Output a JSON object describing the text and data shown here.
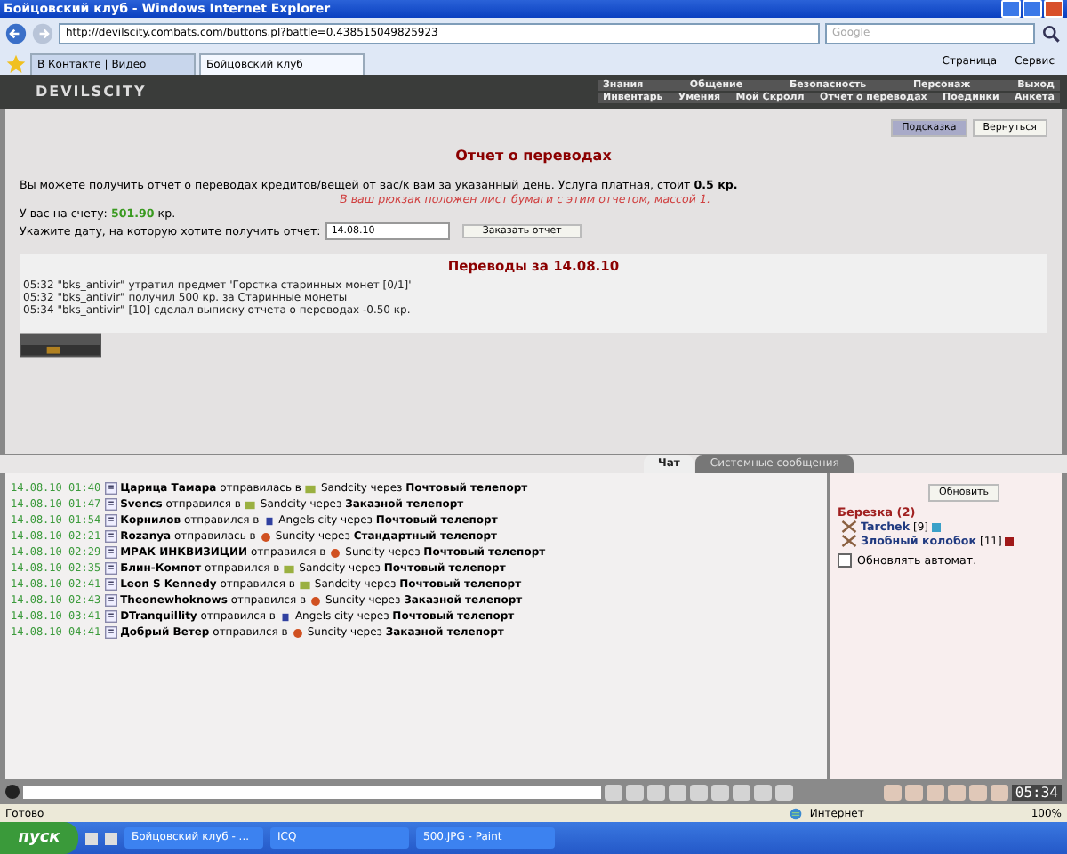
{
  "window": {
    "title": "Бойцовский клуб - Windows Internet Explorer"
  },
  "address": "http://devilscity.combats.com/buttons.pl?battle=0.438515049825923",
  "search": {
    "placeholder": "Google"
  },
  "tabs": [
    {
      "label": "В Контакте | Видео",
      "selected": false
    },
    {
      "label": "Бойцовский клуб",
      "selected": true
    }
  ],
  "toolbar": [
    "Страница",
    "Сервис"
  ],
  "game": {
    "logo": "DEVILSCITY",
    "menu_top": [
      "Знания",
      "Общение",
      "Безопасность",
      "Персонаж",
      "Выход"
    ],
    "menu_sub": [
      "Инвентарь",
      "Умения",
      "Мой Скролл",
      "Отчет о переводах",
      "Поединки",
      "Анкета"
    ]
  },
  "report": {
    "buttons": [
      {
        "label": "Подсказка",
        "selected": true
      },
      {
        "label": "Вернуться",
        "selected": false
      }
    ],
    "title": "Отчет о переводах",
    "intro": "Вы можете получить отчет о переводах кредитов/вещей от вас/к вам за указанный день. Услуга платная, стоит **0.5 кр.**",
    "note": "В ваш рюкзак положен лист бумаги с этим отчетом, массой 1.",
    "balance_label": "У вас на счету:",
    "balance": "501.90",
    "balance_unit": "кр.",
    "date_label": "Укажите дату, на которую хотите получить отчет:",
    "date_value": "14.08.10",
    "submit": "Заказать отчет",
    "list_title": "Переводы за 14.08.10",
    "entries": [
      "05:32 \"bks_antivir\" утратил предмет 'Горстка старинных монет [0/1]'",
      "05:32 \"bks_antivir\" получил 500 кр. за Старинные монеты",
      "05:34 \"bks_antivir\" [10] сделал выписку отчета о переводах -0.50 кр."
    ]
  },
  "chat": {
    "tabs": [
      {
        "label": "Чат",
        "selected": true
      },
      {
        "label": "Системные сообщения",
        "selected": false
      }
    ],
    "messages": [
      {
        "time": "14.08.10 01:40",
        "user": "Царица Тамара",
        "verb": "отправилась в",
        "kind": "sand",
        "city": "Sandcity",
        "via": "через",
        "teleport": "Почтовый телепорт"
      },
      {
        "time": "14.08.10 01:47",
        "user": "Svencs",
        "verb": "отправился в",
        "kind": "sand",
        "city": "Sandcity",
        "via": "через",
        "teleport": "Заказной телепорт"
      },
      {
        "time": "14.08.10 01:54",
        "user": "Корнилов",
        "verb": "отправился в",
        "kind": "angels",
        "city": "Angels city",
        "via": "через",
        "teleport": "Почтовый телепорт"
      },
      {
        "time": "14.08.10 02:21",
        "user": "Rozanya",
        "verb": "отправилась в",
        "kind": "sun",
        "city": "Suncity",
        "via": "через",
        "teleport": "Стандартный телепорт"
      },
      {
        "time": "14.08.10 02:29",
        "user": "МРАК ИНКВИЗИЦИИ",
        "verb": "отправился в",
        "kind": "sun",
        "city": "Suncity",
        "via": "через",
        "teleport": "Почтовый телепорт"
      },
      {
        "time": "14.08.10 02:35",
        "user": "Блин-Компот",
        "verb": "отправился в",
        "kind": "sand",
        "city": "Sandcity",
        "via": "через",
        "teleport": "Почтовый телепорт"
      },
      {
        "time": "14.08.10 02:41",
        "user": "Leon S Kennedy",
        "verb": "отправился в",
        "kind": "sand",
        "city": "Sandcity",
        "via": "через",
        "teleport": "Почтовый телепорт"
      },
      {
        "time": "14.08.10 02:43",
        "user": "Theonewhoknows",
        "verb": "отправился в",
        "kind": "sun",
        "city": "Suncity",
        "via": "через",
        "teleport": "Заказной телепорт"
      },
      {
        "time": "14.08.10 03:41",
        "user": "DTranquillity",
        "verb": "отправился в",
        "kind": "angels",
        "city": "Angels city",
        "via": "через",
        "teleport": "Почтовый телепорт"
      },
      {
        "time": "14.08.10 04:41",
        "user": "Добрый Ветер",
        "verb": "отправился в",
        "kind": "sun",
        "city": "Suncity",
        "via": "через",
        "teleport": "Заказной телепорт"
      }
    ],
    "clock": "05:34"
  },
  "room": {
    "refresh": "Обновить",
    "name": "Березка (2)",
    "users": [
      {
        "name": "Tarchek",
        "level": "[9]",
        "color": "#3aa0c8"
      },
      {
        "name": "Злобный колобок",
        "level": "[11]",
        "color": "#a01818"
      }
    ],
    "auto": {
      "label": "Обновлять автомат.",
      "checked": false
    }
  },
  "status": {
    "text": "Готово",
    "zone": "Интернет",
    "zoom": "100%"
  },
  "taskbar": {
    "start": "пуск",
    "tasks": [
      "Бойцовский клуб - ...",
      "ICQ",
      "500.JPG - Paint"
    ]
  }
}
